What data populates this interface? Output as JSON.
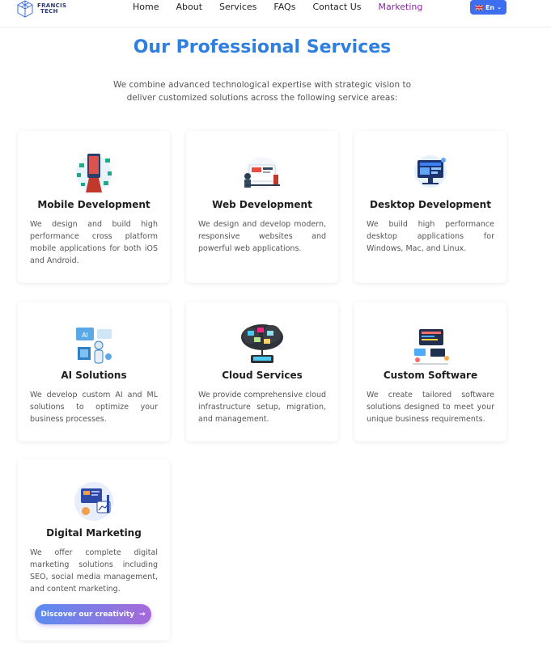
{
  "navbar": {
    "logo_line1": "FRANCIS",
    "logo_line2": "TECH",
    "links": [
      "Home",
      "About",
      "Services",
      "FAQs",
      "Contact Us",
      "Marketing"
    ],
    "active_link": "Marketing",
    "language": "En"
  },
  "header": {
    "title": "Our Professional Services",
    "subtitle": "We combine advanced technological expertise with strategic vision to deliver customized solutions across the following service areas:"
  },
  "services": [
    {
      "title": "Mobile Development",
      "description": "We design and build high performance cross platform mobile applications for both iOS and Android.",
      "icon": "mobile-development-icon"
    },
    {
      "title": "Web Development",
      "description": "We design and develop modern, responsive websites and powerful web applications.",
      "icon": "web-development-icon"
    },
    {
      "title": "Desktop Development",
      "description": "We build high performance desktop applications for Windows, Mac, and Linux.",
      "icon": "desktop-development-icon"
    },
    {
      "title": "AI Solutions",
      "description": "We develop custom AI and ML solutions to optimize your business processes.",
      "icon": "ai-solutions-icon"
    },
    {
      "title": "Cloud Services",
      "description": "We provide comprehensive cloud infrastructure setup, migration, and management.",
      "icon": "cloud-services-icon"
    },
    {
      "title": "Custom Software",
      "description": "We create tailored software solutions designed to meet your unique business requirements.",
      "icon": "custom-software-icon"
    },
    {
      "title": "Digital Marketing",
      "description": "We offer complete digital marketing solutions including SEO, social media management, and content marketing.",
      "icon": "digital-marketing-icon"
    }
  ],
  "cta": {
    "label": "Discover our creativity",
    "arrow": "→"
  },
  "colors": {
    "accent": "#2f7fe0",
    "active_nav": "#8e24aa",
    "lang_button": "#3d6ef0"
  }
}
